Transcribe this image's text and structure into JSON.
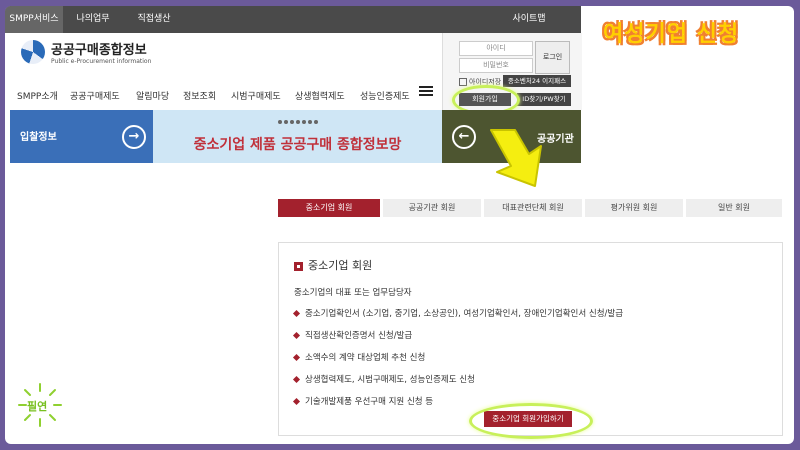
{
  "top_bar": {
    "tabs": [
      "SMPP서비스",
      "나의업무",
      "직접생산"
    ],
    "sitemap": "사이트맵"
  },
  "slide_heading": "여성기업 신청",
  "logo": {
    "text": "공공구매종합정보",
    "sub": "Public e-Procurement information"
  },
  "login": {
    "id_placeholder": "아이디",
    "pw_placeholder": "비밀번호",
    "login_label": "로그인",
    "save_id_label": "아이디저장",
    "easy_label": "중소벤처24 이지패스",
    "join_label": "회원가입",
    "find_label": "ID찾기/PW찾기"
  },
  "nav": [
    "SMPP소개",
    "공공구매제도",
    "알림마당",
    "정보조회",
    "시범구매제도",
    "상생협력제도",
    "성능인증제도"
  ],
  "banner": {
    "left_label": "입찰정보",
    "center_headline": "중소기업 제품 공공구매 종합정보망",
    "right_label": "공공기관"
  },
  "member_tabs": [
    "중소기업 회원",
    "공공기관 회원",
    "대표관련단체 회원",
    "평가위원 회원",
    "일반 회원"
  ],
  "panel": {
    "title": "중소기업 회원",
    "subtitle": "중소기업의 대표 또는 업무담당자",
    "items": [
      "중소기업확인서 (소기업, 중기업, 소상공인), 여성기업확인서, 장애인기업확인서 신청/발급",
      "직접생산확인증명서 신청/발급",
      "소액수의 계약 대상업체 추천 신청",
      "상생협력제도, 시범구매제도, 성능인증제도 신청",
      "기술개발제품 우선구매 지원 신청 등"
    ],
    "apply_label": "중소기업 회원가입하기"
  },
  "sticker": "필연",
  "colors": {
    "accent": "#a3212d",
    "highlight": "#c8f05a",
    "arrow": "#f5ee10",
    "frame": "#6b5a9a"
  }
}
